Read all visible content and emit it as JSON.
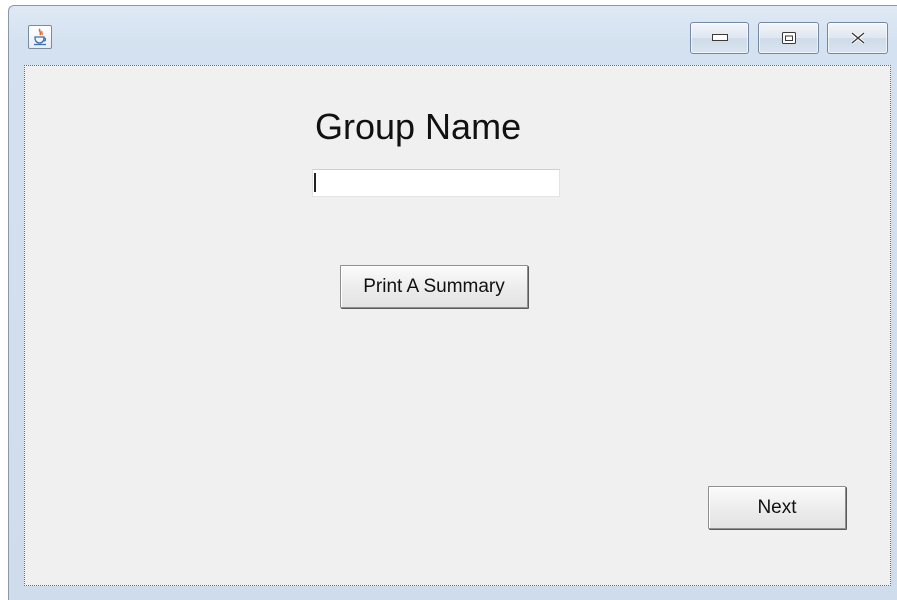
{
  "window": {
    "title": "",
    "controls": {
      "minimize_icon": "minimize-icon",
      "maximize_icon": "maximize-icon",
      "close_icon": "close-icon"
    },
    "app_icon": "java-cup-icon"
  },
  "form": {
    "heading": "Group Name",
    "group_name_value": "",
    "group_name_placeholder": "",
    "summary_button_label": "Print A Summary",
    "next_button_label": "Next"
  },
  "colors": {
    "panel_background": "#f0f0f0",
    "titlebar_background": "#d3e1f0",
    "button_border": "#8e8f8f"
  }
}
